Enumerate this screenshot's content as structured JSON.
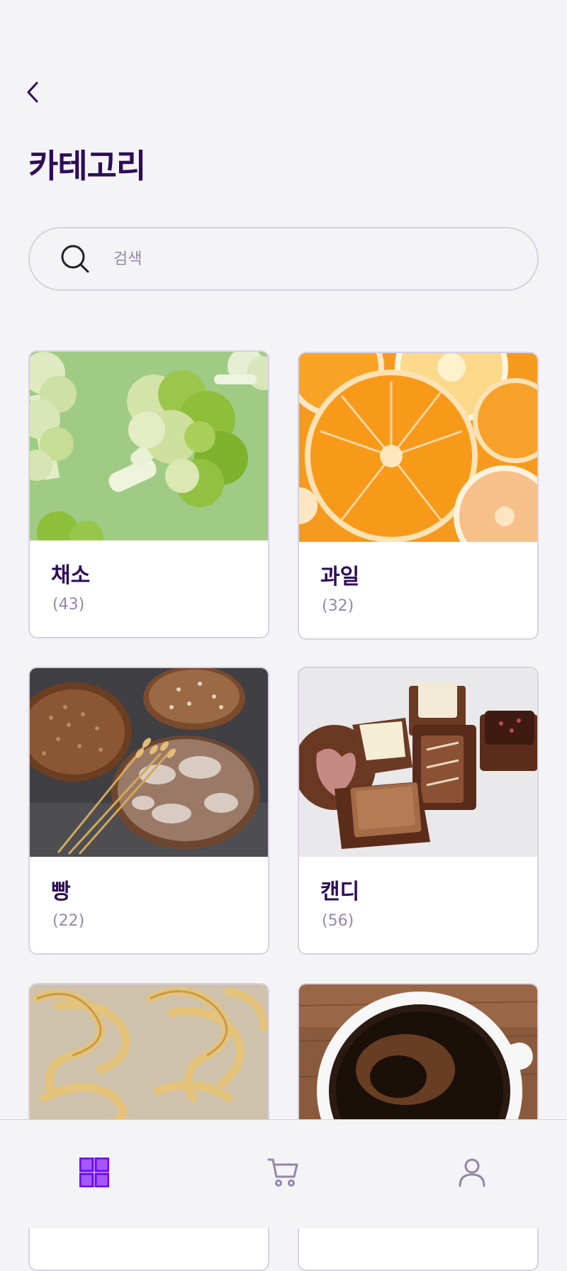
{
  "header": {
    "back_icon": "chevron-left-icon",
    "title": "카테고리"
  },
  "search": {
    "placeholder": "검색",
    "value": "",
    "icon": "search-icon"
  },
  "categories": [
    {
      "name": "채소",
      "count": "(43)",
      "image": "broccoli"
    },
    {
      "name": "과일",
      "count": "(32)",
      "image": "oranges"
    },
    {
      "name": "빵",
      "count": "(22)",
      "image": "bread"
    },
    {
      "name": "캔디",
      "count": "(56)",
      "image": "chocolates"
    },
    {
      "name": "",
      "count": "",
      "image": "pasta"
    },
    {
      "name": "",
      "count": "",
      "image": "coffee"
    }
  ],
  "bottom_nav": {
    "items": [
      {
        "icon": "grid-icon",
        "active": true
      },
      {
        "icon": "cart-icon",
        "active": false
      },
      {
        "icon": "user-icon",
        "active": false
      }
    ],
    "active_color": "#7203ff",
    "inactive_color": "#9586a8"
  },
  "colors": {
    "background": "#f4f4f6",
    "title": "#2d0c57",
    "muted": "#9586a8",
    "border": "#d9d0e3"
  }
}
